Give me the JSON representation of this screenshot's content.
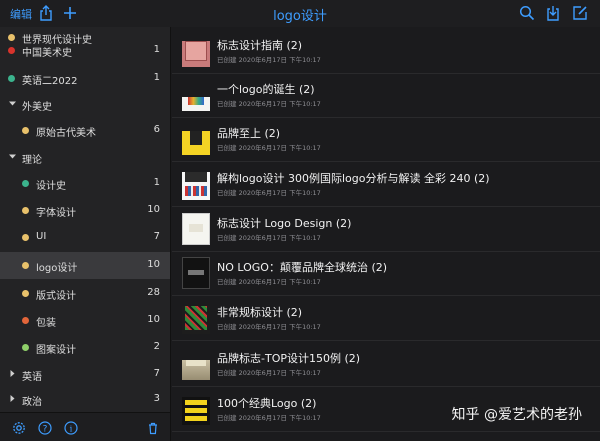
{
  "toolbar": {
    "edit_label": "编辑",
    "title": "logo设计"
  },
  "sidebar": {
    "items": [
      {
        "label": "世界现代设计史",
        "count": "",
        "dot": "#e8c16b",
        "indent": 1,
        "kind": "cut"
      },
      {
        "label": "中国美术史",
        "count": "1",
        "dot": "#d8332c",
        "indent": 1,
        "kind": "item"
      },
      {
        "label": "英语二2022",
        "count": "1",
        "dot": "#3bb38d",
        "indent": 1,
        "kind": "item"
      },
      {
        "label": "外美史",
        "count": "",
        "dot": "",
        "indent": 0,
        "kind": "group-open"
      },
      {
        "label": "原始古代美术",
        "count": "6",
        "dot": "#e8c16b",
        "indent": 2,
        "kind": "item"
      },
      {
        "label": "理论",
        "count": "",
        "dot": "",
        "indent": 0,
        "kind": "group-open"
      },
      {
        "label": "设计史",
        "count": "1",
        "dot": "#3bb38d",
        "indent": 2,
        "kind": "item"
      },
      {
        "label": "字体设计",
        "count": "10",
        "dot": "#e8c16b",
        "indent": 2,
        "kind": "item"
      },
      {
        "label": "UI",
        "count": "7",
        "dot": "#e8c16b",
        "indent": 2,
        "kind": "item"
      },
      {
        "label": "logo设计",
        "count": "10",
        "dot": "#e8c16b",
        "indent": 2,
        "kind": "item",
        "selected": true
      },
      {
        "label": "版式设计",
        "count": "28",
        "dot": "#e8c16b",
        "indent": 2,
        "kind": "item"
      },
      {
        "label": "包装",
        "count": "10",
        "dot": "#e2653a",
        "indent": 2,
        "kind": "item"
      },
      {
        "label": "图案设计",
        "count": "2",
        "dot": "#8fcf6a",
        "indent": 2,
        "kind": "item"
      },
      {
        "label": "英语",
        "count": "7",
        "dot": "",
        "indent": 0,
        "kind": "group-closed"
      },
      {
        "label": "政治",
        "count": "3",
        "dot": "",
        "indent": 0,
        "kind": "group-closed"
      }
    ]
  },
  "list": {
    "items": [
      {
        "title": "标志设计指南 (2)",
        "meta": "已创建 2020年6月17日 下午10:17",
        "thumb": "pink"
      },
      {
        "title": "一个logo的诞生 (2)",
        "meta": "已创建 2020年6月17日 下午10:17",
        "thumb": "white"
      },
      {
        "title": "品牌至上 (2)",
        "meta": "已创建 2020年6月17日 下午10:17",
        "thumb": "yellow"
      },
      {
        "title": "解构logo设计 300例国际logo分析与解读 全彩 240 (2)",
        "meta": "已创建 2020年6月17日 下午10:17",
        "thumb": "white2"
      },
      {
        "title": "标志设计 Logo Design (2)",
        "meta": "已创建 2020年6月17日 下午10:17",
        "thumb": "white3"
      },
      {
        "title": "NO LOGO：颠覆品牌全球统治 (2)",
        "meta": "已创建 2020年6月17日 下午10:17",
        "thumb": "black"
      },
      {
        "title": "非常规标设计 (2)",
        "meta": "已创建 2020年6月17日 下午10:17",
        "thumb": "green"
      },
      {
        "title": "品牌标志-TOP设计150例 (2)",
        "meta": "已创建 2020年6月17日 下午10:17",
        "thumb": "photo"
      },
      {
        "title": "100个经典Logo (2)",
        "meta": "已创建 2020年6月17日 下午10:17",
        "thumb": "yellowblack"
      }
    ]
  },
  "watermark": "知乎 @爱艺术的老孙"
}
